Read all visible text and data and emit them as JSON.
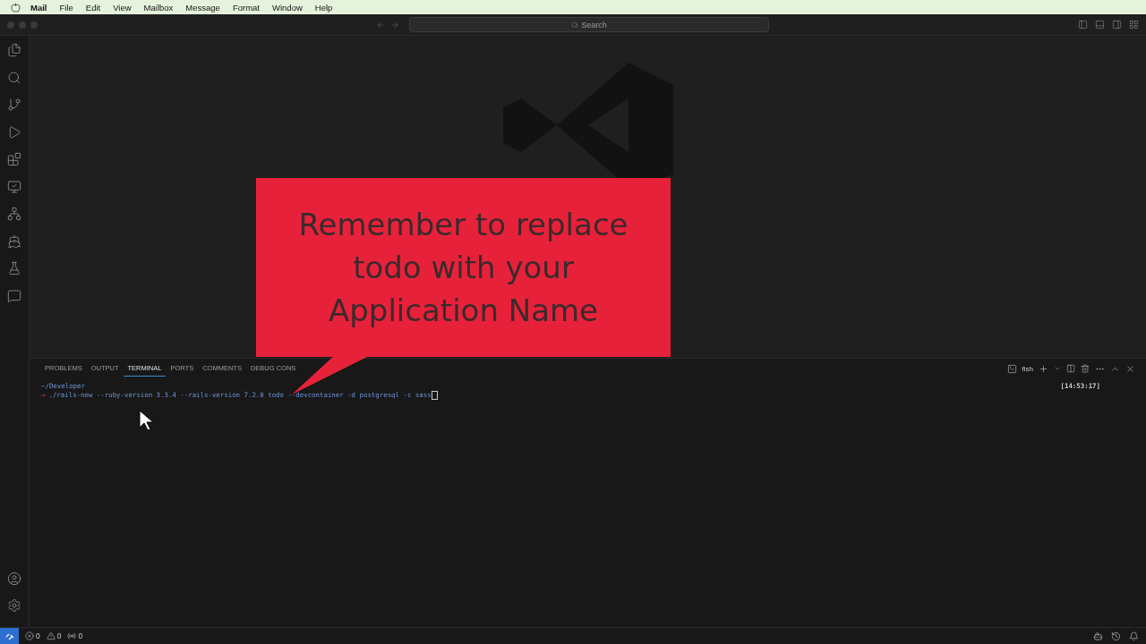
{
  "menu_bar": {
    "app_name": "Mail",
    "items": [
      "File",
      "Edit",
      "View",
      "Mailbox",
      "Message",
      "Format",
      "Window",
      "Help"
    ]
  },
  "title_bar": {
    "search": {
      "placeholder": "Search"
    }
  },
  "callout": {
    "text": "Remember to replace todo with your Application Name"
  },
  "panel": {
    "tabs": [
      {
        "label": "PROBLEMS",
        "selected": false
      },
      {
        "label": "OUTPUT",
        "selected": false
      },
      {
        "label": "TERMINAL",
        "selected": true
      },
      {
        "label": "PORTS",
        "selected": false
      },
      {
        "label": "COMMENTS",
        "selected": false
      },
      {
        "label": "DEBUG CONS",
        "selected": false
      }
    ],
    "terminal_profile": "fish"
  },
  "terminal": {
    "path": "~/Developer",
    "prompt": "→",
    "command": "./rails-new --ruby-version 3.3.4 --rails-version 7.2.0 todo --devcontainer -d postgresql -c sass",
    "timestamp": "[14:53:17]"
  },
  "status_bar": {
    "errors": "0",
    "warnings": "0",
    "ports": "0"
  }
}
